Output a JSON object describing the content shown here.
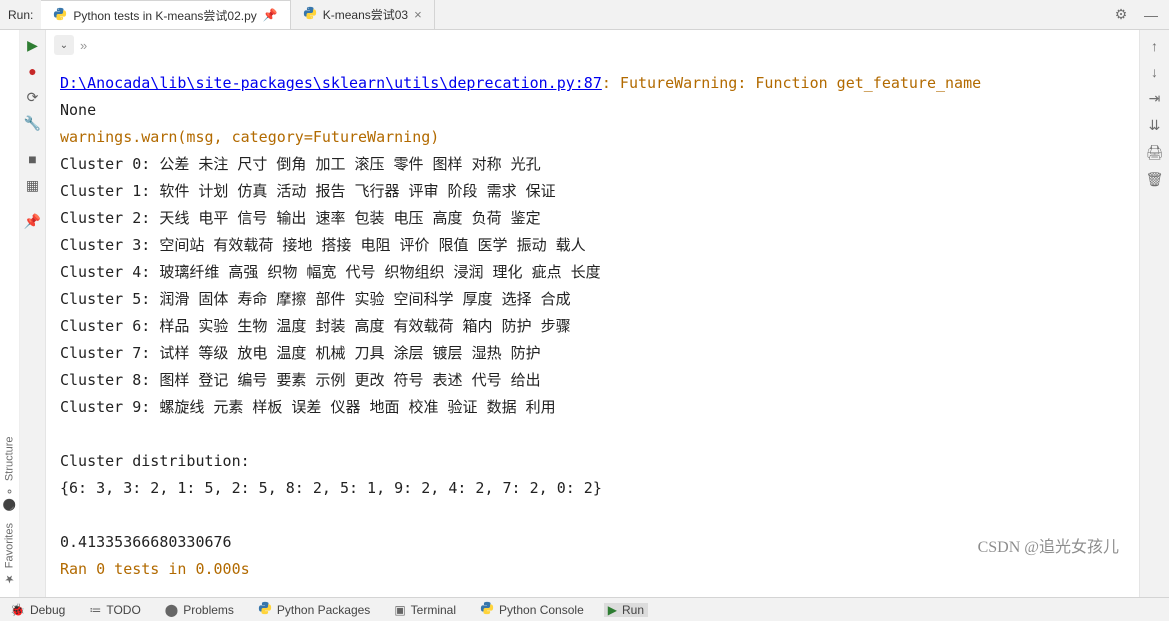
{
  "header": {
    "run_label": "Run:",
    "tabs": [
      {
        "icon": "python",
        "label": "Python tests in K-means尝试02.py",
        "pinned": true,
        "active": true
      },
      {
        "icon": "python",
        "label": "K-means尝试03",
        "closable": true
      }
    ],
    "gear": "⚙",
    "minimize": "—"
  },
  "left_rail": {
    "play": "▶",
    "bp": "●",
    "rerun": "⟳",
    "wrench": "🔧",
    "stop": "■",
    "layout": "▦",
    "pin": "📌"
  },
  "run_toolbar": {
    "breadcrumb": "»",
    "collapse": "⌄"
  },
  "vertical_tabs": {
    "structure": "Structure",
    "favorites": "Favorites"
  },
  "console": {
    "path": "D:\\Anocada\\lib\\site-packages\\sklearn\\utils\\deprecation.py:87",
    "after_path": ": FutureWarning: Function get_feature_name",
    "none": "None",
    "warn": "  warnings.warn(msg, category=FutureWarning)",
    "clusters": [
      "Cluster 0: 公差 未注 尺寸 倒角 加工 滚压 零件 图样 对称 光孔",
      "Cluster 1: 软件 计划 仿真 活动 报告 飞行器 评审 阶段 需求 保证",
      "Cluster 2: 天线 电平 信号 输出 速率 包装 电压 高度 负荷 鉴定",
      "Cluster 3: 空间站 有效载荷 接地 搭接 电阻 评价 限值 医学 振动 载人",
      "Cluster 4: 玻璃纤维 高强 织物 幅宽 代号 织物组织 浸润 理化 疵点 长度",
      "Cluster 5: 润滑 固体 寿命 摩擦 部件 实验 空间科学 厚度 选择 合成",
      "Cluster 6: 样品 实验 生物 温度 封装 高度 有效载荷 箱内 防护 步骤",
      "Cluster 7: 试样 等级 放电 温度 机械 刀具 涂层 镀层 湿热 防护",
      "Cluster 8: 图样 登记 编号 要素 示例 更改 符号 表述 代号 给出",
      "Cluster 9: 螺旋线 元素 样板 误差 仪器 地面 校准 验证 数据 利用"
    ],
    "dist_label": "Cluster distribution:",
    "dist": "{6: 3, 3: 2, 1: 5, 2: 5, 8: 2, 5: 1, 9: 2, 4: 2, 7: 2, 0: 2}",
    "score": "0.41335366680330676",
    "ran": "Ran 0 tests in 0.000s",
    "watermark": "CSDN @追光女孩儿"
  },
  "right_rail": {
    "up": "↑",
    "down": "↓",
    "wrap": "⇥",
    "scroll": "⇊",
    "print": "🖨",
    "trash": "🗑"
  },
  "footer": {
    "items": [
      {
        "icon": "🐞",
        "label": "Debug"
      },
      {
        "icon": "≔",
        "label": "TODO"
      },
      {
        "icon": "⬤",
        "label": "Problems"
      },
      {
        "icon": "py",
        "label": "Python Packages"
      },
      {
        "icon": ">_",
        "label": "Terminal"
      },
      {
        "icon": "py",
        "label": "Python Console"
      },
      {
        "icon": "▶",
        "label": "Run",
        "active": true
      }
    ]
  }
}
